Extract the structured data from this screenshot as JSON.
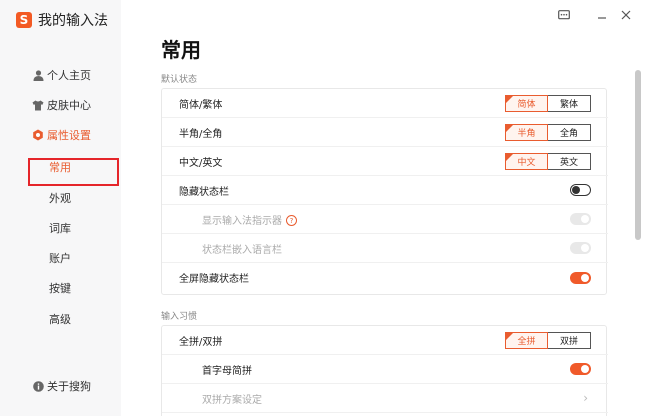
{
  "app": {
    "name": "我的输入法",
    "logo_char": "S"
  },
  "sidebar": {
    "items": [
      {
        "label": "个人主页",
        "icon": "person-icon"
      },
      {
        "label": "皮肤中心",
        "icon": "shirt-icon"
      },
      {
        "label": "属性设置",
        "icon": "hexagon-settings-icon"
      }
    ],
    "subitems": [
      "常用",
      "外观",
      "词库",
      "账户",
      "按键",
      "高级"
    ],
    "about": {
      "label": "关于搜狗",
      "icon": "info-icon"
    }
  },
  "window": {
    "menu_icon": "message-icon",
    "minimize_icon": "minimize-icon",
    "close_icon": "close-icon"
  },
  "page": {
    "title": "常用",
    "sections": [
      {
        "label": "默认状态",
        "rows": [
          {
            "label": "简体/繁体",
            "type": "segment",
            "options": [
              "简体",
              "繁体"
            ],
            "selected": 0
          },
          {
            "label": "半角/全角",
            "type": "segment",
            "options": [
              "半角",
              "全角"
            ],
            "selected": 0
          },
          {
            "label": "中文/英文",
            "type": "segment",
            "options": [
              "中文",
              "英文"
            ],
            "selected": 0
          },
          {
            "label": "隐藏状态栏",
            "type": "toggle",
            "on": false
          },
          {
            "label": "显示输入法指示器",
            "type": "toggle",
            "on": true,
            "disabled": true,
            "help": "?"
          },
          {
            "label": "状态栏嵌入语言栏",
            "type": "toggle",
            "on": true,
            "disabled": true
          },
          {
            "label": "全屏隐藏状态栏",
            "type": "toggle",
            "on": true
          }
        ]
      },
      {
        "label": "输入习惯",
        "rows": [
          {
            "label": "全拼/双拼",
            "type": "segment",
            "options": [
              "全拼",
              "双拼"
            ],
            "selected": 0
          },
          {
            "label": "首字母简拼",
            "type": "toggle",
            "on": true
          },
          {
            "label": "双拼方案设定",
            "type": "link",
            "disabled": true
          }
        ]
      }
    ]
  },
  "colors": {
    "accent": "#e95c2f",
    "toggle_on": "#f05a2a",
    "highlight_box": "#e5252a",
    "sidebar_bg": "#f7f7f8"
  }
}
